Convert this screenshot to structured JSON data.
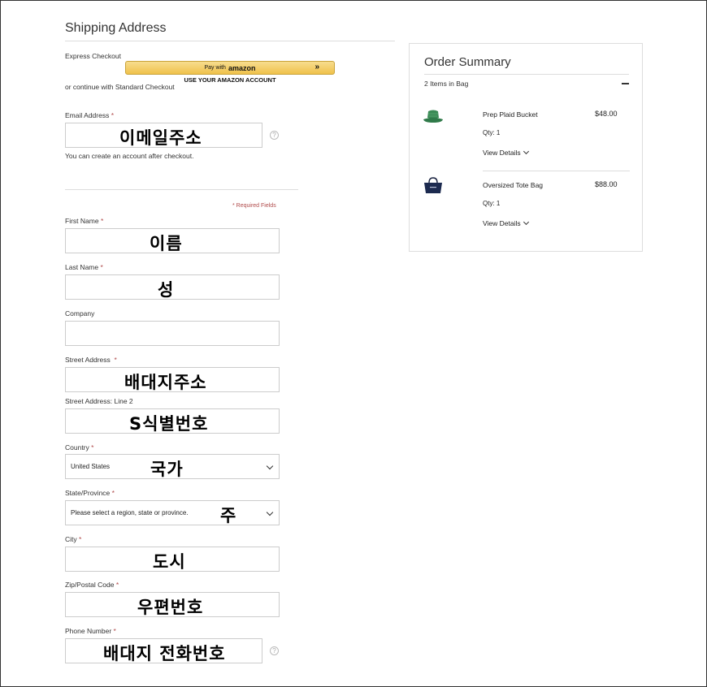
{
  "shipping": {
    "title": "Shipping Address",
    "express_label": "Express Checkout",
    "amazon_pay_prefix": "Pay with",
    "amazon_pay_brand": "amazon",
    "amazon_pay_arrows": "»",
    "amazon_account_note": "USE YOUR AMAZON ACCOUNT",
    "standard_label": "or continue with Standard Checkout",
    "required_note": "* Required Fields",
    "required_mark": "*",
    "help_glyph": "?"
  },
  "fields": {
    "email": {
      "label": "Email Address",
      "overlay": "이메일주소",
      "note": "You can create an account after checkout."
    },
    "first_name": {
      "label": "First Name",
      "overlay": "이름"
    },
    "last_name": {
      "label": "Last Name",
      "overlay": "성"
    },
    "company": {
      "label": "Company"
    },
    "street": {
      "label": "Street Address",
      "overlay": "배대지주소"
    },
    "street2": {
      "label": "Street Address: Line 2",
      "overlay": "S식별번호"
    },
    "country": {
      "label": "Country",
      "value": "United States",
      "overlay": "국가"
    },
    "state": {
      "label": "State/Province",
      "placeholder": "Please select a region, state or province.",
      "overlay": "주"
    },
    "city": {
      "label": "City",
      "overlay": "도시"
    },
    "zip": {
      "label": "Zip/Postal Code",
      "overlay": "우편번호"
    },
    "phone": {
      "label": "Phone Number",
      "overlay": "배대지 전화번호"
    }
  },
  "summary": {
    "title": "Order Summary",
    "count": "2 Items in Bag",
    "items": [
      {
        "name": "Prep Plaid Bucket",
        "price": "$48.00",
        "qty": "Qty: 1",
        "details": "View Details"
      },
      {
        "name": "Oversized Tote Bag",
        "price": "$88.00",
        "qty": "Qty: 1",
        "details": "View Details"
      }
    ]
  }
}
